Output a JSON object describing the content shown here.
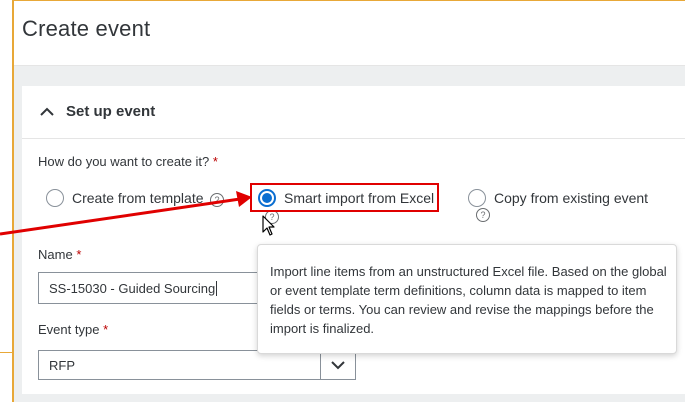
{
  "page": {
    "title": "Create event"
  },
  "section": {
    "title": "Set up event"
  },
  "create_question": {
    "label": "How do you want to create it?",
    "required_mark": "*"
  },
  "options": [
    {
      "label": "Create from template",
      "selected": false,
      "help": "?"
    },
    {
      "label": "Smart import from Excel",
      "selected": true,
      "help": "?"
    },
    {
      "label": "Copy from existing event",
      "selected": false,
      "help": "?"
    }
  ],
  "name_field": {
    "label": "Name",
    "required_mark": "*",
    "value": "SS-15030 - Guided Sourcing"
  },
  "event_type": {
    "label": "Event type",
    "required_mark": "*",
    "value": "RFP"
  },
  "popover": {
    "text": "Import line items from an unstructured Excel file. Based on the global or event template term definitions, column data is mapped to item fields or terms. You can review and revise the mappings before the import is finalized."
  },
  "colors": {
    "accent": "#0a6ed1",
    "annotation": "#e00000",
    "frame": "#e8a838",
    "required": "#bb0000"
  }
}
